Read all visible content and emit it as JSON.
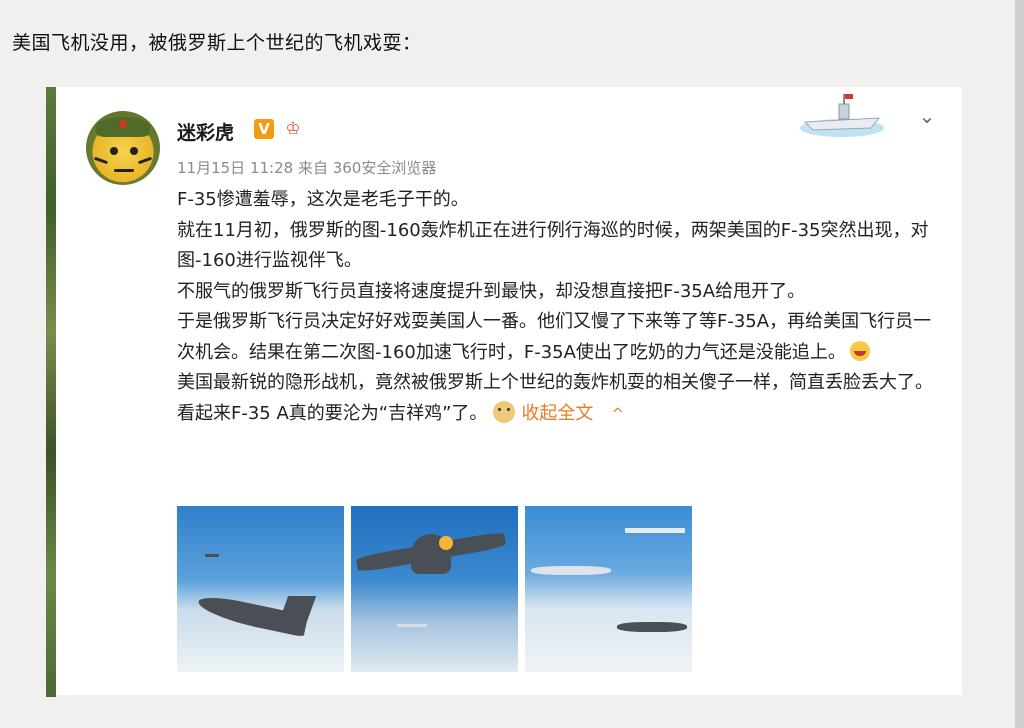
{
  "caption": "美国飞机没用，被俄罗斯上个世纪的飞机戏耍：",
  "post": {
    "username": "迷彩虎",
    "verified_badge": "V",
    "meta": "11月15日 11:28 来自 360安全浏览器",
    "paragraphs": [
      "F-35惨遭羞辱，这次是老毛子干的。",
      "就在11月初，俄罗斯的图-160轰炸机正在进行例行海巡的时候，两架美国的F-35突然出现，对图-160进行监视伴飞。",
      "不服气的俄罗斯飞行员直接将速度提升到最快，却没想直接把F-35A给甩开了。",
      "于是俄罗斯飞行员决定好好戏耍美国人一番。他们又慢了下来等了等F-35A，再给美国飞行员一次机会。结果在第二次图-160加速飞行时，F-35A使出了吃奶的力气还是没能追上。",
      "美国最新锐的隐形战机，竟然被俄罗斯上个世纪的轰炸机耍的相关傻子一样，简直丢脸丢大了。看起来F-35 A真的要沦为“吉祥鸡”了。"
    ],
    "collapse_label": "收起全文",
    "collapse_arrow": "^",
    "expand_chevron": "⌄"
  },
  "colors": {
    "accent": "#e67e22",
    "meta_text": "#8a8a8a",
    "badge": "#f39c12"
  },
  "icons": {
    "avatar": "tiger-avatar",
    "badge": "verified-v-icon",
    "crown": "crown-icon",
    "ship": "aircraft-carrier-icon",
    "laugh": "laugh-emoji",
    "doge": "doge-emoji"
  }
}
